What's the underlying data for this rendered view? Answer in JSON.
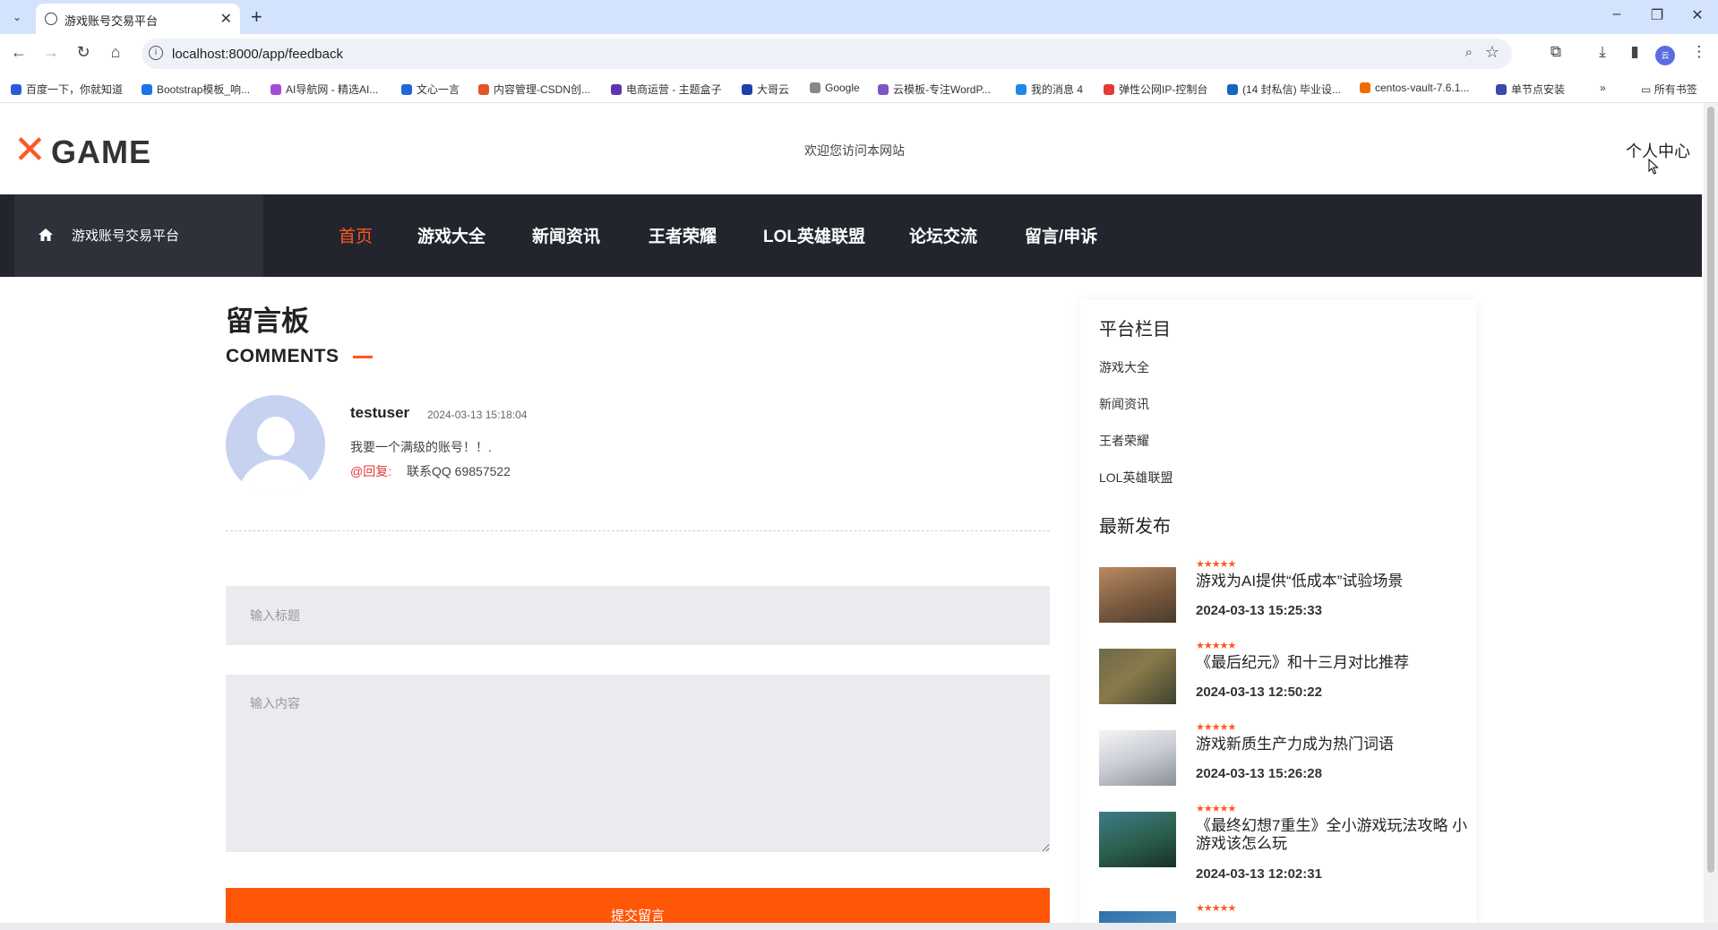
{
  "browser": {
    "tab_title": "游戏账号交易平台",
    "url": "localhost:8000/app/feedback",
    "bookmarks": [
      {
        "label": "百度一下，你就知道",
        "color": "#2b5cd8"
      },
      {
        "label": "Bootstrap模板_响...",
        "color": "#1a73e8"
      },
      {
        "label": "AI导航网 - 精选AI...",
        "color": "#a64bd8"
      },
      {
        "label": "文心一言",
        "color": "#2266dd"
      },
      {
        "label": "内容管理-CSDN创...",
        "color": "#e5532d"
      },
      {
        "label": "电商运营 - 主题盒子",
        "color": "#5e35b1"
      },
      {
        "label": "大哥云",
        "color": "#1e40af"
      },
      {
        "label": "Google",
        "color": "#888888"
      },
      {
        "label": "云模板-专注WordP...",
        "color": "#7e57c2"
      },
      {
        "label": "我的消息 4",
        "color": "#1e88e5"
      },
      {
        "label": "弹性公网IP-控制台",
        "color": "#e53935"
      },
      {
        "label": "(14 封私信) 毕业设...",
        "color": "#1565c0"
      },
      {
        "label": "centos-vault-7.6.1...",
        "color": "#ef6c00"
      },
      {
        "label": "单节点安装",
        "color": "#3949ab"
      }
    ],
    "all_bookmarks": "所有书签",
    "profile_initials": "云"
  },
  "header": {
    "logo_text": "GAME",
    "welcome": "欢迎您访问本网站",
    "personal_center": "个人中心"
  },
  "nav": {
    "brand": "游戏账号交易平台",
    "items": [
      "首页",
      "游戏大全",
      "新闻资讯",
      "王者荣耀",
      "LOL英雄联盟",
      "论坛交流",
      "留言/申诉"
    ],
    "active_index": 0
  },
  "main": {
    "title": "留言板",
    "subtitle": "COMMENTS",
    "comments": [
      {
        "user": "testuser",
        "date": "2024-03-13 15:18:04",
        "text": "我要一个满级的账号！！.",
        "reply_label": "@回复:",
        "reply": "联系QQ 69857522"
      }
    ],
    "form": {
      "title_placeholder": "输入标题",
      "content_placeholder": "输入内容",
      "submit_label": "提交留言"
    }
  },
  "sidebar": {
    "section1_title": "平台栏目",
    "links": [
      "游戏大全",
      "新闻资讯",
      "王者荣耀",
      "LOL英雄联盟"
    ],
    "section2_title": "最新发布",
    "posts": [
      {
        "title": "游戏为AI提供“低成本”试验场景",
        "date": "2024-03-13 15:25:33",
        "stars": "★★★★★"
      },
      {
        "title": "《最后纪元》和十三月对比推荐",
        "date": "2024-03-13 12:50:22",
        "stars": "★★★★★"
      },
      {
        "title": "游戏新质生产力成为热门词语",
        "date": "2024-03-13 15:26:28",
        "stars": "★★★★★"
      },
      {
        "title": "《最终幻想7重生》全小游戏玩法攻略 小游戏该怎么玩",
        "date": "2024-03-13 12:02:31",
        "stars": "★★★★★"
      },
      {
        "title": "",
        "date": "",
        "stars": "★★★★★"
      }
    ]
  }
}
